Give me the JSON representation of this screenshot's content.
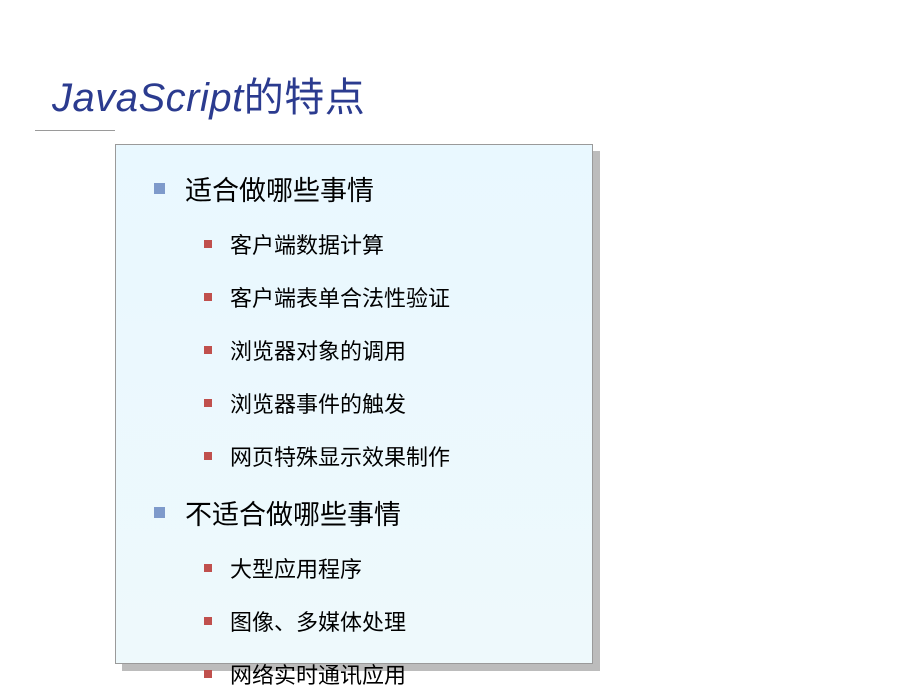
{
  "title": {
    "en": "JavaScript",
    "cn": "的特点"
  },
  "sections": [
    {
      "heading": "适合做哪些事情",
      "items": [
        "客户端数据计算",
        "客户端表单合法性验证",
        "浏览器对象的调用",
        "浏览器事件的触发",
        "网页特殊显示效果制作"
      ]
    },
    {
      "heading": "不适合做哪些事情",
      "items": [
        "大型应用程序",
        "图像、多媒体处理",
        "网络实时通讯应用"
      ]
    }
  ]
}
